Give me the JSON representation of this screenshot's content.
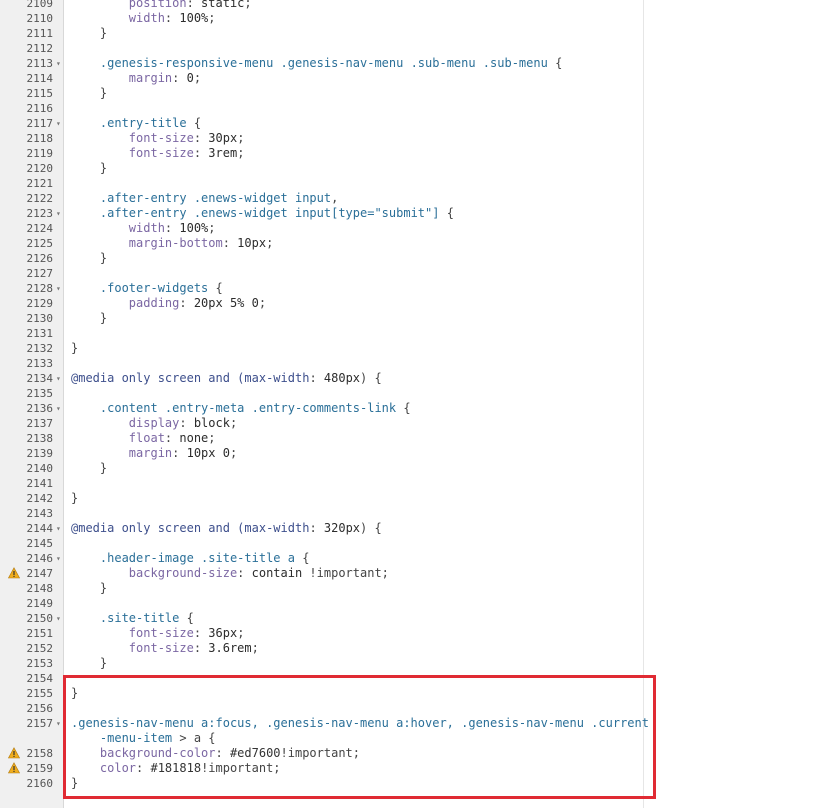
{
  "colors": {
    "selector": "#2a6f98",
    "property": "#7b67a3",
    "value": "#2c2c2c",
    "number": "#2c2c2c",
    "keyword": "#3d4f8c",
    "punct": "#444444",
    "string": "#333333",
    "highlight_border": "#e02a33",
    "warning": "#f0ad1e"
  },
  "lines": [
    {
      "n": "2109",
      "fold": false,
      "warn": false,
      "tokens": [
        {
          "t": "        "
        },
        {
          "t": "position",
          "c": "property"
        },
        {
          "t": ": ",
          "c": "punct"
        },
        {
          "t": "static",
          "c": "value"
        },
        {
          "t": ";",
          "c": "punct"
        }
      ]
    },
    {
      "n": "2110",
      "fold": false,
      "warn": false,
      "tokens": [
        {
          "t": "        "
        },
        {
          "t": "width",
          "c": "property"
        },
        {
          "t": ": ",
          "c": "punct"
        },
        {
          "t": "100%",
          "c": "number"
        },
        {
          "t": ";",
          "c": "punct"
        }
      ]
    },
    {
      "n": "2111",
      "fold": false,
      "warn": false,
      "tokens": [
        {
          "t": "    }",
          "c": "punct"
        }
      ]
    },
    {
      "n": "2112",
      "fold": false,
      "warn": false,
      "tokens": []
    },
    {
      "n": "2113",
      "fold": true,
      "warn": false,
      "tokens": [
        {
          "t": "    "
        },
        {
          "t": ".genesis-responsive-menu .genesis-nav-menu .sub-menu .sub-menu",
          "c": "selector"
        },
        {
          "t": " {",
          "c": "punct"
        }
      ]
    },
    {
      "n": "2114",
      "fold": false,
      "warn": false,
      "tokens": [
        {
          "t": "        "
        },
        {
          "t": "margin",
          "c": "property"
        },
        {
          "t": ": ",
          "c": "punct"
        },
        {
          "t": "0",
          "c": "number"
        },
        {
          "t": ";",
          "c": "punct"
        }
      ]
    },
    {
      "n": "2115",
      "fold": false,
      "warn": false,
      "tokens": [
        {
          "t": "    }",
          "c": "punct"
        }
      ]
    },
    {
      "n": "2116",
      "fold": false,
      "warn": false,
      "tokens": []
    },
    {
      "n": "2117",
      "fold": true,
      "warn": false,
      "tokens": [
        {
          "t": "    "
        },
        {
          "t": ".entry-title",
          "c": "selector"
        },
        {
          "t": " {",
          "c": "punct"
        }
      ]
    },
    {
      "n": "2118",
      "fold": false,
      "warn": false,
      "tokens": [
        {
          "t": "        "
        },
        {
          "t": "font-size",
          "c": "property"
        },
        {
          "t": ": ",
          "c": "punct"
        },
        {
          "t": "30px",
          "c": "number"
        },
        {
          "t": ";",
          "c": "punct"
        }
      ]
    },
    {
      "n": "2119",
      "fold": false,
      "warn": false,
      "tokens": [
        {
          "t": "        "
        },
        {
          "t": "font-size",
          "c": "property"
        },
        {
          "t": ": ",
          "c": "punct"
        },
        {
          "t": "3rem",
          "c": "number"
        },
        {
          "t": ";",
          "c": "punct"
        }
      ]
    },
    {
      "n": "2120",
      "fold": false,
      "warn": false,
      "tokens": [
        {
          "t": "    }",
          "c": "punct"
        }
      ]
    },
    {
      "n": "2121",
      "fold": false,
      "warn": false,
      "tokens": []
    },
    {
      "n": "2122",
      "fold": false,
      "warn": false,
      "tokens": [
        {
          "t": "    "
        },
        {
          "t": ".after-entry .enews-widget input",
          "c": "selector"
        },
        {
          "t": ",",
          "c": "punct"
        }
      ]
    },
    {
      "n": "2123",
      "fold": true,
      "warn": false,
      "tokens": [
        {
          "t": "    "
        },
        {
          "t": ".after-entry .enews-widget input[type=\"submit\"]",
          "c": "selector"
        },
        {
          "t": " {",
          "c": "punct"
        }
      ]
    },
    {
      "n": "2124",
      "fold": false,
      "warn": false,
      "tokens": [
        {
          "t": "        "
        },
        {
          "t": "width",
          "c": "property"
        },
        {
          "t": ": ",
          "c": "punct"
        },
        {
          "t": "100%",
          "c": "number"
        },
        {
          "t": ";",
          "c": "punct"
        }
      ]
    },
    {
      "n": "2125",
      "fold": false,
      "warn": false,
      "tokens": [
        {
          "t": "        "
        },
        {
          "t": "margin-bottom",
          "c": "property"
        },
        {
          "t": ": ",
          "c": "punct"
        },
        {
          "t": "10px",
          "c": "number"
        },
        {
          "t": ";",
          "c": "punct"
        }
      ]
    },
    {
      "n": "2126",
      "fold": false,
      "warn": false,
      "tokens": [
        {
          "t": "    }",
          "c": "punct"
        }
      ]
    },
    {
      "n": "2127",
      "fold": false,
      "warn": false,
      "tokens": []
    },
    {
      "n": "2128",
      "fold": true,
      "warn": false,
      "tokens": [
        {
          "t": "    "
        },
        {
          "t": ".footer-widgets",
          "c": "selector"
        },
        {
          "t": " {",
          "c": "punct"
        }
      ]
    },
    {
      "n": "2129",
      "fold": false,
      "warn": false,
      "tokens": [
        {
          "t": "        "
        },
        {
          "t": "padding",
          "c": "property"
        },
        {
          "t": ": ",
          "c": "punct"
        },
        {
          "t": "20px 5% 0",
          "c": "number"
        },
        {
          "t": ";",
          "c": "punct"
        }
      ]
    },
    {
      "n": "2130",
      "fold": false,
      "warn": false,
      "tokens": [
        {
          "t": "    }",
          "c": "punct"
        }
      ]
    },
    {
      "n": "2131",
      "fold": false,
      "warn": false,
      "tokens": []
    },
    {
      "n": "2132",
      "fold": false,
      "warn": false,
      "tokens": [
        {
          "t": "}",
          "c": "punct"
        }
      ]
    },
    {
      "n": "2133",
      "fold": false,
      "warn": false,
      "tokens": []
    },
    {
      "n": "2134",
      "fold": true,
      "warn": false,
      "tokens": [
        {
          "t": "@media",
          "c": "keyword"
        },
        {
          "t": " only screen and (",
          "c": "keyword"
        },
        {
          "t": "max-width",
          "c": "keyword"
        },
        {
          "t": ": ",
          "c": "punct"
        },
        {
          "t": "480px",
          "c": "number"
        },
        {
          "t": ") {",
          "c": "punct"
        }
      ]
    },
    {
      "n": "2135",
      "fold": false,
      "warn": false,
      "tokens": []
    },
    {
      "n": "2136",
      "fold": true,
      "warn": false,
      "tokens": [
        {
          "t": "    "
        },
        {
          "t": ".content .entry-meta .entry-comments-link",
          "c": "selector"
        },
        {
          "t": " {",
          "c": "punct"
        }
      ]
    },
    {
      "n": "2137",
      "fold": false,
      "warn": false,
      "tokens": [
        {
          "t": "        "
        },
        {
          "t": "display",
          "c": "property"
        },
        {
          "t": ": ",
          "c": "punct"
        },
        {
          "t": "block",
          "c": "value"
        },
        {
          "t": ";",
          "c": "punct"
        }
      ]
    },
    {
      "n": "2138",
      "fold": false,
      "warn": false,
      "tokens": [
        {
          "t": "        "
        },
        {
          "t": "float",
          "c": "property"
        },
        {
          "t": ": ",
          "c": "punct"
        },
        {
          "t": "none",
          "c": "value"
        },
        {
          "t": ";",
          "c": "punct"
        }
      ]
    },
    {
      "n": "2139",
      "fold": false,
      "warn": false,
      "tokens": [
        {
          "t": "        "
        },
        {
          "t": "margin",
          "c": "property"
        },
        {
          "t": ": ",
          "c": "punct"
        },
        {
          "t": "10px 0",
          "c": "number"
        },
        {
          "t": ";",
          "c": "punct"
        }
      ]
    },
    {
      "n": "2140",
      "fold": false,
      "warn": false,
      "tokens": [
        {
          "t": "    }",
          "c": "punct"
        }
      ]
    },
    {
      "n": "2141",
      "fold": false,
      "warn": false,
      "tokens": []
    },
    {
      "n": "2142",
      "fold": false,
      "warn": false,
      "tokens": [
        {
          "t": "}",
          "c": "punct"
        }
      ]
    },
    {
      "n": "2143",
      "fold": false,
      "warn": false,
      "tokens": []
    },
    {
      "n": "2144",
      "fold": true,
      "warn": false,
      "tokens": [
        {
          "t": "@media",
          "c": "keyword"
        },
        {
          "t": " only screen and (",
          "c": "keyword"
        },
        {
          "t": "max-width",
          "c": "keyword"
        },
        {
          "t": ": ",
          "c": "punct"
        },
        {
          "t": "320px",
          "c": "number"
        },
        {
          "t": ") {",
          "c": "punct"
        }
      ]
    },
    {
      "n": "2145",
      "fold": false,
      "warn": false,
      "tokens": []
    },
    {
      "n": "2146",
      "fold": true,
      "warn": false,
      "tokens": [
        {
          "t": "    "
        },
        {
          "t": ".header-image .site-title a",
          "c": "selector"
        },
        {
          "t": " {",
          "c": "punct"
        }
      ]
    },
    {
      "n": "2147",
      "fold": false,
      "warn": true,
      "tokens": [
        {
          "t": "        "
        },
        {
          "t": "background-size",
          "c": "property"
        },
        {
          "t": ": ",
          "c": "punct"
        },
        {
          "t": "contain",
          "c": "value"
        },
        {
          "t": " !important;",
          "c": "punct"
        }
      ]
    },
    {
      "n": "2148",
      "fold": false,
      "warn": false,
      "tokens": [
        {
          "t": "    }",
          "c": "punct"
        }
      ]
    },
    {
      "n": "2149",
      "fold": false,
      "warn": false,
      "tokens": []
    },
    {
      "n": "2150",
      "fold": true,
      "warn": false,
      "tokens": [
        {
          "t": "    "
        },
        {
          "t": ".site-title",
          "c": "selector"
        },
        {
          "t": " {",
          "c": "punct"
        }
      ]
    },
    {
      "n": "2151",
      "fold": false,
      "warn": false,
      "tokens": [
        {
          "t": "        "
        },
        {
          "t": "font-size",
          "c": "property"
        },
        {
          "t": ": ",
          "c": "punct"
        },
        {
          "t": "36px",
          "c": "number"
        },
        {
          "t": ";",
          "c": "punct"
        }
      ]
    },
    {
      "n": "2152",
      "fold": false,
      "warn": false,
      "tokens": [
        {
          "t": "        "
        },
        {
          "t": "font-size",
          "c": "property"
        },
        {
          "t": ": ",
          "c": "punct"
        },
        {
          "t": "3.6rem",
          "c": "number"
        },
        {
          "t": ";",
          "c": "punct"
        }
      ]
    },
    {
      "n": "2153",
      "fold": false,
      "warn": false,
      "tokens": [
        {
          "t": "    }",
          "c": "punct"
        }
      ]
    },
    {
      "n": "2154",
      "fold": false,
      "warn": false,
      "tokens": []
    },
    {
      "n": "2155",
      "fold": false,
      "warn": false,
      "tokens": [
        {
          "t": "}",
          "c": "punct"
        }
      ]
    },
    {
      "n": "2156",
      "fold": false,
      "warn": false,
      "tokens": []
    },
    {
      "n": "2157",
      "fold": true,
      "warn": false,
      "tokens": [
        {
          "t": ".genesis-nav-menu a:focus, .genesis-nav-menu a:hover, .genesis-nav-menu .current",
          "c": "selector"
        }
      ]
    },
    {
      "n": "",
      "fold": false,
      "warn": false,
      "tokens": [
        {
          "t": "    "
        },
        {
          "t": "-menu-item",
          "c": "selector"
        },
        {
          "t": " > a {",
          "c": "punct"
        }
      ]
    },
    {
      "n": "2158",
      "fold": false,
      "warn": true,
      "tokens": [
        {
          "t": "    "
        },
        {
          "t": "background-color",
          "c": "property"
        },
        {
          "t": ": ",
          "c": "punct"
        },
        {
          "t": "#ed7600",
          "c": "string"
        },
        {
          "t": "!important;",
          "c": "punct"
        }
      ]
    },
    {
      "n": "2159",
      "fold": false,
      "warn": true,
      "tokens": [
        {
          "t": "    "
        },
        {
          "t": "color",
          "c": "property"
        },
        {
          "t": ": ",
          "c": "punct"
        },
        {
          "t": "#181818",
          "c": "string"
        },
        {
          "t": "!important;",
          "c": "punct"
        }
      ]
    },
    {
      "n": "2160",
      "fold": false,
      "warn": false,
      "tokens": [
        {
          "t": "}",
          "c": "punct"
        }
      ]
    }
  ]
}
